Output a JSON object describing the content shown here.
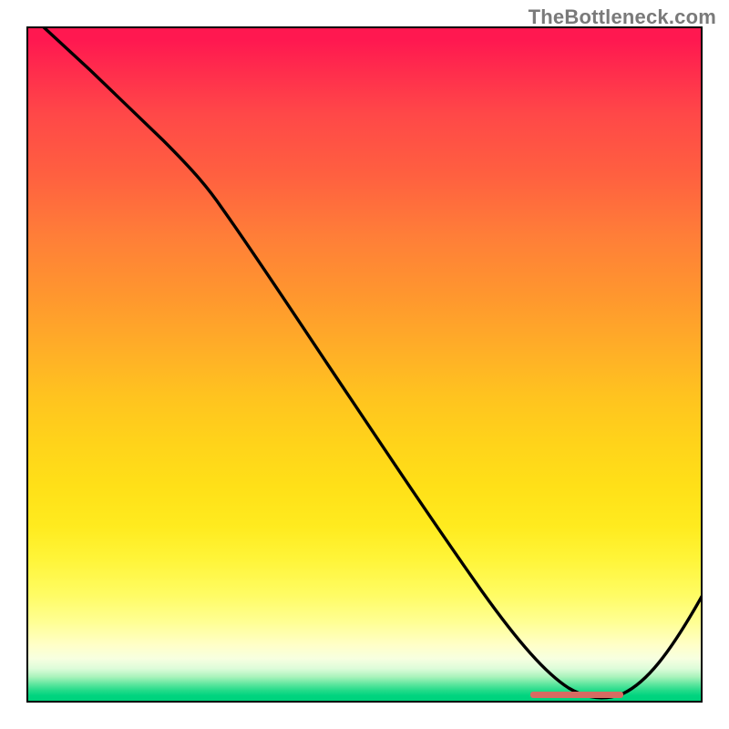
{
  "watermark": "TheBottleneck.com",
  "chart_data": {
    "type": "line",
    "title": "",
    "xlabel": "",
    "ylabel": "",
    "xlim": [
      0,
      100
    ],
    "ylim": [
      0,
      100
    ],
    "background_gradient": {
      "orientation": "vertical",
      "stops": [
        {
          "pos": 0,
          "color": "#ff1850"
        },
        {
          "pos": 50,
          "color": "#ffc020"
        },
        {
          "pos": 88,
          "color": "#ffff90"
        },
        {
          "pos": 100,
          "color": "#00d17c"
        }
      ]
    },
    "series": [
      {
        "name": "bottleneck-curve",
        "color": "#000000",
        "x": [
          3,
          10,
          20,
          27,
          35,
          45,
          55,
          65,
          72,
          77,
          82,
          86,
          90,
          95,
          100
        ],
        "y": [
          100,
          92,
          81,
          74,
          62,
          48,
          34,
          20,
          10,
          4,
          1,
          0,
          2,
          8,
          17
        ]
      }
    ],
    "annotations": [
      {
        "name": "optimal-range-marker",
        "type": "bar",
        "color": "#d86b62",
        "x_start": 77,
        "x_end": 89,
        "y": 0
      }
    ]
  },
  "layout": {
    "marker_left_pct": 74.5,
    "marker_width_pct": 13.8
  }
}
